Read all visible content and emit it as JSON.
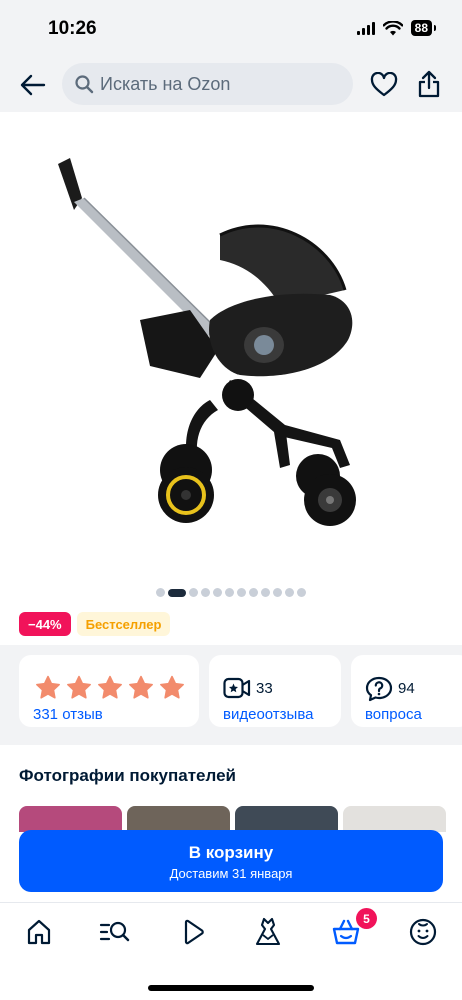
{
  "status_bar": {
    "time": "10:26",
    "battery": "88"
  },
  "header": {
    "search_placeholder": "Искать на Ozon"
  },
  "carousel": {
    "count": 12,
    "active_index": 1
  },
  "badges": {
    "discount": "−44%",
    "bestseller": "Бестселлер"
  },
  "rating": {
    "stars": 5,
    "reviews_label": "331 отзыв"
  },
  "videos": {
    "count": "33",
    "label": "видеоотзыва"
  },
  "questions": {
    "count": "94",
    "label": "вопроса"
  },
  "photos": {
    "title": "Фотографии покупателей"
  },
  "cart_button": {
    "title": "В корзину",
    "subtitle": "Доставим 31 января"
  },
  "tabbar": {
    "cart_count": "5"
  },
  "colors": {
    "brand_blue": "#005bff",
    "accent_pink": "#f1135a",
    "star_orange": "#f28b6c",
    "bestseller_text": "#f5a000"
  }
}
